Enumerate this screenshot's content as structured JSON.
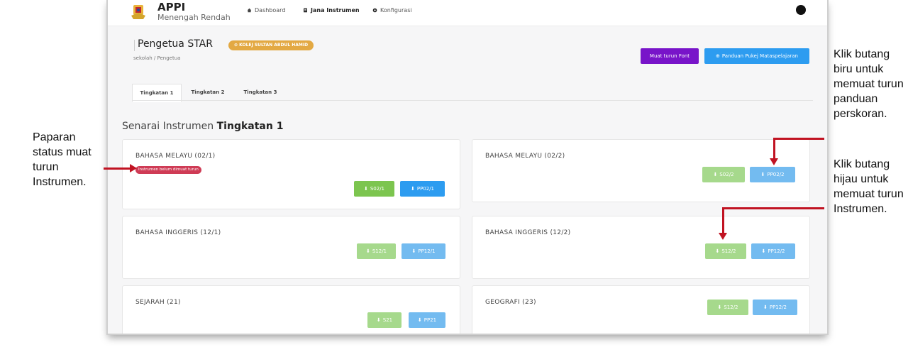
{
  "brand": {
    "title": "APPI",
    "subtitle": "Menengah Rendah"
  },
  "nav": [
    {
      "label": "Dashboard",
      "icon": "home-icon"
    },
    {
      "label": "Jana Instrumen",
      "icon": "document-icon"
    },
    {
      "label": "Konfigurasi",
      "icon": "gear-icon"
    }
  ],
  "page": {
    "title": "Pengetua STAR",
    "school_badge": "KOLEJ SULTAN ABDUL HAMID",
    "breadcrumb": "sekolah / Pengetua"
  },
  "actions": {
    "download_font": "Muat turun Font",
    "download_guide": "Panduan Pukej Mataspelajaran"
  },
  "tabs": [
    "Tingkatan 1",
    "Tingkatan 2",
    "Tingkatan 3"
  ],
  "section": {
    "prefix": "Senarai Instrumen",
    "level": "Tingkatan 1"
  },
  "cards": [
    {
      "title": "BAHASA MELAYU (02/1)",
      "status": "Instrumen belum dimuat turun",
      "btn_green": "S02/1",
      "btn_blue": "PP02/1"
    },
    {
      "title": "BAHASA MELAYU (02/2)",
      "status": "",
      "btn_green": "S02/2",
      "btn_blue": "PP02/2"
    },
    {
      "title": "BAHASA INGGERIS (12/1)",
      "status": "",
      "btn_green": "S12/1",
      "btn_blue": "PP12/1"
    },
    {
      "title": "BAHASA INGGERIS (12/2)",
      "status": "",
      "btn_green": "S12/2",
      "btn_blue": "PP12/2"
    },
    {
      "title": "SEJARAH (21)",
      "status": "",
      "btn_green": "S21",
      "btn_blue": "PP21"
    },
    {
      "title": "GEOGRAFI (23)",
      "status": "",
      "btn_green": "S12/2",
      "btn_blue": "PP12/2"
    }
  ],
  "annotations": {
    "left": "Paparan status muat turun Instrumen.",
    "right_top": "Klik butang biru untuk memuat turun panduan perskoran.",
    "right_bottom": "Klik butang hijau untuk memuat turun Instrumen."
  },
  "colors": {
    "purple": "#7814c9",
    "blue": "#2d9cf0",
    "green": "#7cc54f",
    "badge_orange": "#e3a943",
    "status_red": "#cf3b55",
    "arrow_red": "#c11322"
  }
}
